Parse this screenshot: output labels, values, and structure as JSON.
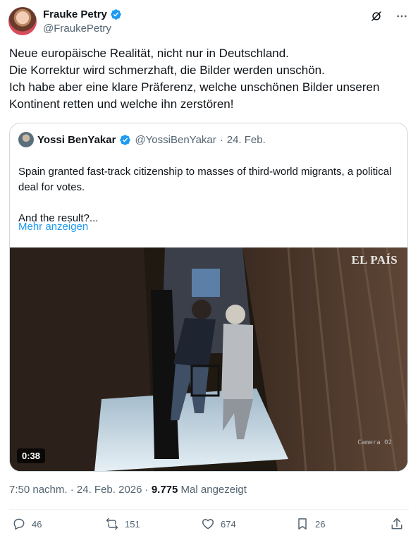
{
  "author": {
    "display_name": "Frauke Petry",
    "handle": "@FraukePetry",
    "avatar_icon": "avatar"
  },
  "header_actions": [
    "grok-icon",
    "more-icon"
  ],
  "tweet": {
    "text": "Neue europäische Realität, nicht nur in Deutschland.\nDie Korrektur wird schmerzhaft, die Bilder werden unschön.\nIch habe aber eine klare Präferenz, welche unschönen Bilder unseren Kontinent retten und welche ihn zerstören!"
  },
  "quoted": {
    "display_name": "Yossi BenYakar",
    "handle": "@YossiBenYakar",
    "separator": "·",
    "date": "24. Feb.",
    "text": "Spain granted fast-track citizenship to masses of third-world migrants, a political deal for votes.\n\nAnd the result?...",
    "show_more": "Mehr anzeigen",
    "video": {
      "watermark": "EL PAÍS",
      "camera_label": "Camera 02",
      "duration": "0:38"
    }
  },
  "meta": {
    "time": "7:50 nachm.",
    "separator": "·",
    "date": "24. Feb. 2026",
    "views_count": "9.775",
    "views_label": "Mal angezeigt"
  },
  "actions": {
    "replies": "46",
    "reposts": "151",
    "likes": "674",
    "bookmarks": "26"
  },
  "colors": {
    "accent": "#1d9bf0",
    "text": "#0f1419",
    "secondary": "#536471",
    "border": "#cfd9de"
  }
}
